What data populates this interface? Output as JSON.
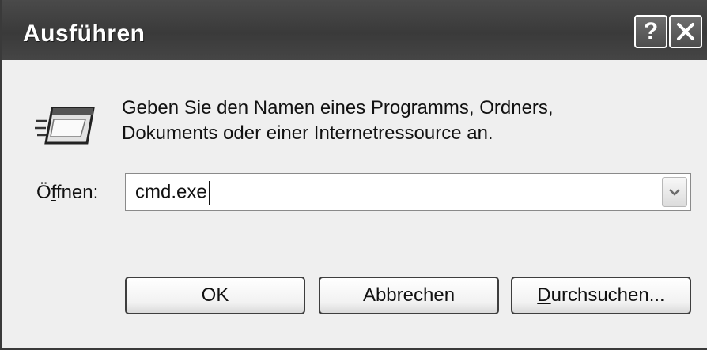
{
  "window": {
    "title": "Ausführen",
    "help_label": "?",
    "close_icon": "close-icon"
  },
  "dialog": {
    "icon": "run-icon",
    "description_line1": "Geben Sie den Namen eines Programms, Ordners,",
    "description_line2": "Dokuments oder einer Internetressource an.",
    "open_label_prefix": "Ö",
    "open_label_mnemonic": "f",
    "open_label_rest": "fnen:",
    "open_value": "cmd.exe",
    "dropdown_icon": "chevron-down-icon"
  },
  "buttons": {
    "ok": "OK",
    "cancel": "Abbrechen",
    "browse_mnemonic": "D",
    "browse_rest": "urchsuchen..."
  }
}
